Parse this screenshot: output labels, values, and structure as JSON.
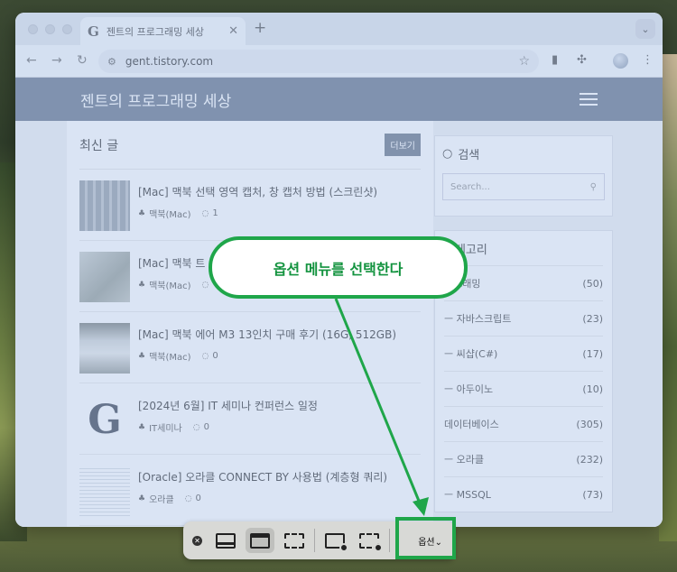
{
  "browser": {
    "tab_title": "젠트의 프로그래밍 세상",
    "tab_icon": "G",
    "url": "gent.tistory.com"
  },
  "blog": {
    "title": "젠트의 프로그래밍 세상",
    "recent_heading": "최신 글",
    "more_label": "더보기",
    "posts": [
      {
        "title": "[Mac] 맥북 선택 영역 캡처, 창 캡처 방법 (스크린샷)",
        "category": "맥북(Mac)",
        "comments": "1"
      },
      {
        "title": "[Mac] 맥북 트",
        "category": "맥북(Mac)",
        "comments": ""
      },
      {
        "title": "[Mac] 맥북 에어 M3 13인치 구매 후기 (16G, 512GB)",
        "category": "맥북(Mac)",
        "comments": "0"
      },
      {
        "title": "[2024년 6월] IT 세미나 컨퍼런스 일정",
        "category": "IT세미나",
        "comments": "0"
      },
      {
        "title": "[Oracle] 오라클 CONNECT BY 사용법 (계층형 쿼리)",
        "category": "오라클",
        "comments": "0"
      }
    ]
  },
  "sidebar": {
    "search_heading": "검색",
    "search_placeholder": "Search...",
    "category_heading": "카테고리",
    "categories": [
      {
        "name": "로그래밍",
        "count": "(50)"
      },
      {
        "name": "ㅡ  자바스크립트",
        "count": "(23)"
      },
      {
        "name": "ㅡ  씨샵(C#)",
        "count": "(17)"
      },
      {
        "name": "ㅡ  아두이노",
        "count": "(10)"
      },
      {
        "name": "데이터베이스",
        "count": "(305)"
      },
      {
        "name": "ㅡ  오라클",
        "count": "(232)"
      },
      {
        "name": "ㅡ  MSSQL",
        "count": "(73)"
      }
    ]
  },
  "callout": {
    "text": "옵션 메뉴를 선택한다",
    "color": "#1fa64a"
  },
  "capture_toolbar": {
    "options_label": "옵션⌄"
  }
}
